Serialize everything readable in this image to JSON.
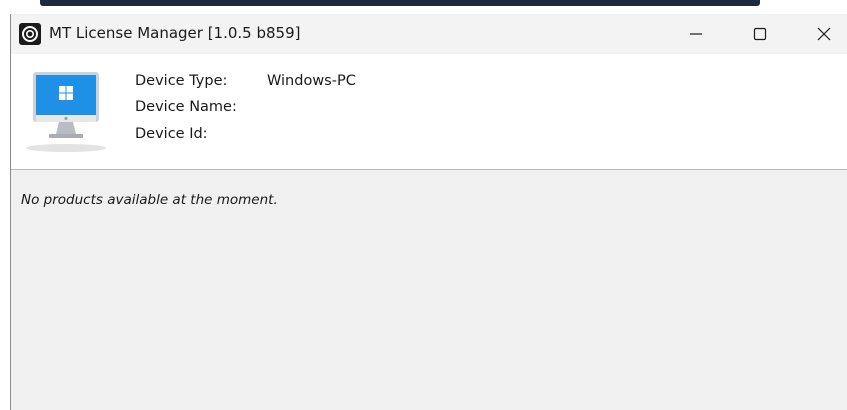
{
  "window": {
    "title": "MT License Manager [1.0.5 b859]",
    "app_icon": "circle-logo-icon",
    "controls": {
      "minimize": "minimize-icon",
      "maximize": "maximize-icon",
      "close": "close-icon"
    }
  },
  "device": {
    "icon": "desktop-computer-icon",
    "fields": [
      {
        "label": "Device Type:",
        "value": "Windows-PC"
      },
      {
        "label": "Device Name:",
        "value": ""
      },
      {
        "label": "Device Id:",
        "value": ""
      }
    ]
  },
  "products": {
    "empty_message": "No products available at the moment."
  },
  "colors": {
    "titlebar_bg": "#f3f3f3",
    "header_bg": "#ffffff",
    "content_bg": "#f0f0f0",
    "screen_blue": "#1e90e6",
    "text": "#1a1a1a"
  }
}
